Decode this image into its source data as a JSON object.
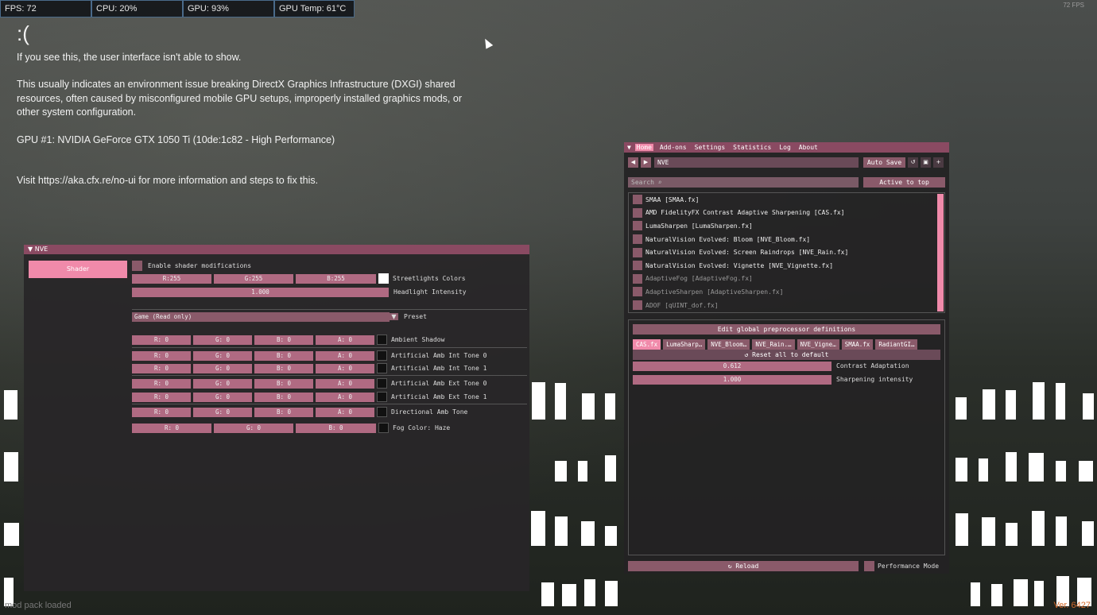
{
  "stats": {
    "fps": "FPS: 72",
    "cpu": "CPU: 20%",
    "gpu": "GPU: 93%",
    "temp": "GPU Temp: 61°C"
  },
  "corner_fps": "72 FPS",
  "error": {
    "face": ":(",
    "line1": "If you see this, the user interface isn't able to show.",
    "line2": "This usually indicates an environment issue breaking DirectX Graphics Infrastructure (DXGI) shared resources, often caused by misconfigured mobile GPU setups, improperly installed graphics mods, or other system configuration.",
    "line3": "GPU #1: NVIDIA GeForce GTX 1050 Ti (10de:1c82 - High Performance)",
    "line4": "Visit https://aka.cfx.re/no-ui for more information and steps to fix this."
  },
  "footer": {
    "modpack": "mod pack loaded",
    "version": "Ver. 6427"
  },
  "nve": {
    "title": "NVE",
    "side_button": "Shader",
    "enable_label": "Enable shader modifications",
    "streetlights": {
      "r": "R:255",
      "g": "G:255",
      "b": "B:255",
      "label": "Streetlights Colors"
    },
    "headlight": {
      "value": "1.000",
      "label": "Headlight Intensity"
    },
    "preset": {
      "value": "Game (Read only)",
      "label": "Preset"
    },
    "rows": [
      {
        "r": "R:  0",
        "g": "G:  0",
        "b": "B:  0",
        "a": "A:  0",
        "label": "Ambient Shadow"
      },
      {
        "r": "R:  0",
        "g": "G:  0",
        "b": "B:  0",
        "a": "A:  0",
        "label": "Artificial Amb Int Tone 0"
      },
      {
        "r": "R:  0",
        "g": "G:  0",
        "b": "B:  0",
        "a": "A:  0",
        "label": "Artificial Amb Int Tone 1"
      },
      {
        "r": "R:  0",
        "g": "G:  0",
        "b": "B:  0",
        "a": "A:  0",
        "label": "Artificial Amb Ext Tone 0"
      },
      {
        "r": "R:  0",
        "g": "G:  0",
        "b": "B:  0",
        "a": "A:  0",
        "label": "Artificial Amb Ext Tone 1"
      },
      {
        "r": "R:  0",
        "g": "G:  0",
        "b": "B:  0",
        "a": "A:  0",
        "label": "Directional Amb Tone"
      }
    ],
    "fog": {
      "r": "R:  0",
      "g": "G:  0",
      "b": "B:  0",
      "label": "Fog Color: Haze"
    }
  },
  "reshade": {
    "menu": [
      "Home",
      "Add-ons",
      "Settings",
      "Statistics",
      "Log",
      "About"
    ],
    "preset_name": "NVE",
    "auto_save": "Auto Save",
    "search_placeholder": "Search",
    "active_to_top": "Active to top",
    "effects": [
      {
        "name": "SMAA [SMAA.fx]",
        "dim": false
      },
      {
        "name": "AMD FidelityFX Contrast Adaptive Sharpening [CAS.fx]",
        "dim": false
      },
      {
        "name": "LumaSharpen [LumaSharpen.fx]",
        "dim": false
      },
      {
        "name": "NaturalVision Evolved: Bloom [NVE_Bloom.fx]",
        "dim": false
      },
      {
        "name": "NaturalVision Evolved: Screen Raindrops [NVE_Rain.fx]",
        "dim": false
      },
      {
        "name": "NaturalVision Evolved: Vignette [NVE_Vignette.fx]",
        "dim": false
      },
      {
        "name": "AdaptiveFog [AdaptiveFog.fx]",
        "dim": true
      },
      {
        "name": "AdaptiveSharpen [AdaptiveSharpen.fx]",
        "dim": true
      },
      {
        "name": "ADOF [qUINT_dof.fx]",
        "dim": true
      }
    ],
    "edit_global": "Edit global preprocessor definitions",
    "tabs": [
      "CAS.fx",
      "LumaSharp…",
      "NVE_Bloom…",
      "NVE_Rain.…",
      "NVE_Vigne…",
      "SMAA.fx",
      "RadiantGI…"
    ],
    "reset_all": "Reset all to default",
    "contrast": {
      "value": "0.612",
      "label": "Contrast Adaptation"
    },
    "sharpen": {
      "value": "1.000",
      "label": "Sharpening intensity"
    },
    "reload": "Reload",
    "perf_mode": "Performance Mode"
  }
}
